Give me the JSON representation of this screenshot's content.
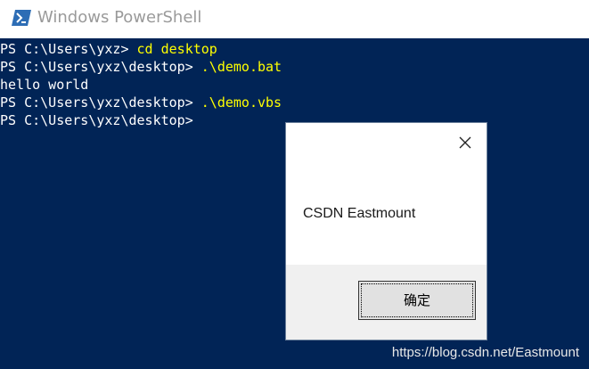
{
  "window": {
    "title": "Windows PowerShell",
    "icon": "powershell-icon"
  },
  "console": {
    "background": "#012456",
    "prompt_color": "#ffffff",
    "command_color": "#ffff00",
    "lines": [
      {
        "prompt": "PS C:\\Users\\yxz> ",
        "command": "cd desktop",
        "output": ""
      },
      {
        "prompt": "PS C:\\Users\\yxz\\desktop> ",
        "command": ".\\demo.bat",
        "output": ""
      },
      {
        "prompt": "",
        "command": "",
        "output": "hello world"
      },
      {
        "prompt": "PS C:\\Users\\yxz\\desktop> ",
        "command": ".\\demo.vbs",
        "output": ""
      },
      {
        "prompt": "PS C:\\Users\\yxz\\desktop>",
        "command": "",
        "output": ""
      }
    ]
  },
  "message_box": {
    "message": "CSDN Eastmount",
    "ok_label": "确定",
    "close_icon": "close-icon"
  },
  "watermark": "https://blog.csdn.net/Eastmount"
}
